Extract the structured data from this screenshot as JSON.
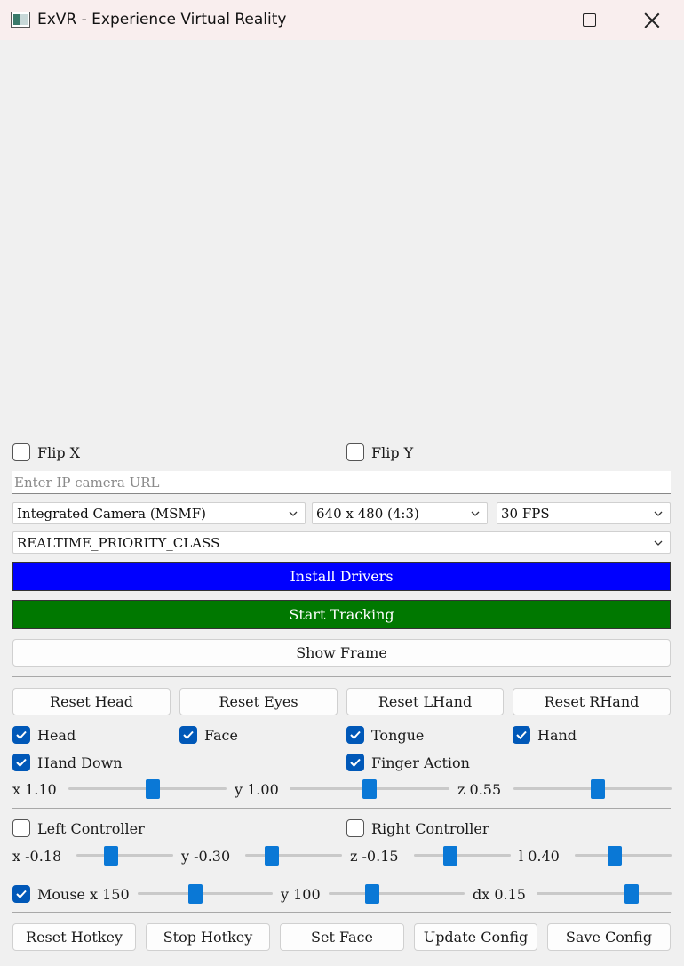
{
  "window": {
    "title": "ExVR - Experience Virtual Reality"
  },
  "flip": {
    "x_label": "Flip X",
    "x_checked": false,
    "y_label": "Flip Y",
    "y_checked": false
  },
  "ip": {
    "placeholder": "Enter IP camera URL",
    "value": ""
  },
  "camera": {
    "selected": "Integrated Camera (MSMF)"
  },
  "resolution": {
    "selected": "640 x 480 (4:3)"
  },
  "fps": {
    "selected": "30 FPS"
  },
  "priority": {
    "selected": "REALTIME_PRIORITY_CLASS"
  },
  "buttons": {
    "install_drivers": "Install Drivers",
    "start_tracking": "Start Tracking",
    "show_frame": "Show Frame",
    "reset_head": "Reset Head",
    "reset_eyes": "Reset Eyes",
    "reset_lhand": "Reset LHand",
    "reset_rhand": "Reset RHand",
    "reset_hotkey": "Reset Hotkey",
    "stop_hotkey": "Stop Hotkey",
    "set_face": "Set Face",
    "update_config": "Update Config",
    "save_config": "Save Config"
  },
  "colors": {
    "install_bg": "#0000ff",
    "start_bg": "#007800",
    "accent": "#0a78d6"
  },
  "tracking": {
    "head": {
      "label": "Head",
      "checked": true
    },
    "face": {
      "label": "Face",
      "checked": true
    },
    "tongue": {
      "label": "Tongue",
      "checked": true
    },
    "hand": {
      "label": "Hand",
      "checked": true
    },
    "hand_down": {
      "label": "Hand Down",
      "checked": true
    },
    "finger_action": {
      "label": "Finger Action",
      "checked": true
    }
  },
  "hand_sliders": {
    "x": {
      "label": "x 1.10",
      "fraction": 0.54
    },
    "y": {
      "label": "y 1.00",
      "fraction": 0.5
    },
    "z": {
      "label": "z 0.55",
      "fraction": 0.54
    }
  },
  "controllers": {
    "left": {
      "label": "Left Controller",
      "checked": false
    },
    "right": {
      "label": "Right Controller",
      "checked": false
    }
  },
  "controller_sliders": {
    "x": {
      "label": "x -0.18",
      "fraction": 0.33
    },
    "y": {
      "label": "y -0.30",
      "fraction": 0.24
    },
    "z": {
      "label": "z -0.15",
      "fraction": 0.35
    },
    "l": {
      "label": "l 0.40",
      "fraction": 0.4
    }
  },
  "mouse": {
    "label": "Mouse",
    "checked": true,
    "x": {
      "label": "x 150",
      "fraction": 0.42
    },
    "y": {
      "label": "y 100",
      "fraction": 0.3
    },
    "dx": {
      "label": "dx 0.15",
      "fraction": 0.73
    }
  }
}
